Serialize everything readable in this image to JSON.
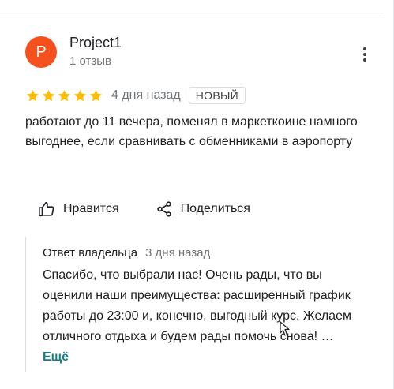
{
  "review": {
    "author": {
      "initial": "P",
      "name": "Project1",
      "reviews": "1 отзыв",
      "avatar_color": "#f4511e"
    },
    "rating": 5,
    "star_color": "#fbbc04",
    "date": "4 дня назад",
    "badge": "НОВЫЙ",
    "text": "работают до 11 вечера, поменял в маркеткоине намного выгоднее, если сравнивать с обменниками в аэропорту"
  },
  "actions": {
    "like": "Нравится",
    "share": "Поделиться"
  },
  "owner_reply": {
    "label": "Ответ владельца",
    "date": "3 дня назад",
    "text": "Спасибо, что выбрали нас! Очень рады, что вы оценили наши преимущества: расширенный график работы до 23:00 и, конечно, выгодный курс. Желаем отличного отдыха и будем рады помочь снова! …",
    "more_label": "Ещё"
  }
}
